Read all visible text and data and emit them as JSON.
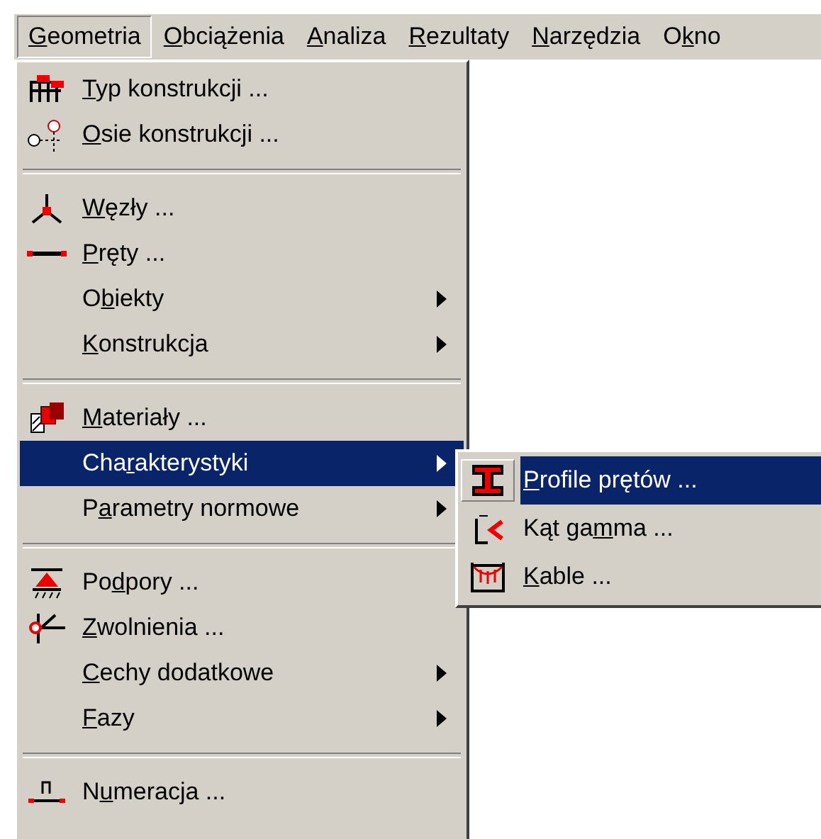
{
  "menubar": [
    {
      "key": "G",
      "post": "eometria",
      "selected": true
    },
    {
      "key": "O",
      "post": "bciążenia",
      "selected": false
    },
    {
      "key": "A",
      "post": "naliza",
      "selected": false
    },
    {
      "key": "R",
      "post": "ezultaty",
      "selected": false
    },
    {
      "key": "N",
      "post": "arzędzia",
      "selected": false
    },
    {
      "pre": "O",
      "key": "k",
      "post": "no",
      "selected": false
    }
  ],
  "menu": [
    {
      "kind": "item",
      "key": "T",
      "post": "yp konstrukcji ...",
      "submenu": false,
      "selected": false
    },
    {
      "kind": "item",
      "key": "O",
      "post": "sie konstrukcji ...",
      "submenu": false,
      "selected": false
    },
    {
      "kind": "separator"
    },
    {
      "kind": "item",
      "key": "W",
      "post": "ęzły ...",
      "submenu": false,
      "selected": false
    },
    {
      "kind": "item",
      "key": "P",
      "post": "ręty ...",
      "submenu": false,
      "selected": false
    },
    {
      "kind": "item",
      "pre": "O",
      "key": "b",
      "post": "iekty",
      "submenu": true,
      "selected": false
    },
    {
      "kind": "item",
      "key": "K",
      "post": "onstrukcja",
      "submenu": true,
      "selected": false
    },
    {
      "kind": "separator"
    },
    {
      "kind": "item",
      "key": "M",
      "post": "ateriały ...",
      "submenu": false,
      "selected": false
    },
    {
      "kind": "item",
      "pre": "Cha",
      "key": "r",
      "post": "akterystyki",
      "submenu": true,
      "selected": true
    },
    {
      "kind": "item",
      "pre": "P",
      "key": "a",
      "post": "rametry normowe",
      "submenu": true,
      "selected": false
    },
    {
      "kind": "separator"
    },
    {
      "kind": "item",
      "pre": "Po",
      "key": "d",
      "post": "pory ...",
      "submenu": false,
      "selected": false
    },
    {
      "kind": "item",
      "key": "Z",
      "post": "wolnienia ...",
      "submenu": false,
      "selected": false
    },
    {
      "kind": "item",
      "key": "C",
      "post": "echy dodatkowe",
      "submenu": true,
      "selected": false
    },
    {
      "kind": "item",
      "key": "F",
      "post": "azy",
      "submenu": true,
      "selected": false
    },
    {
      "kind": "separator"
    },
    {
      "kind": "item",
      "pre": "N",
      "key": "u",
      "post": "meracja ...",
      "submenu": false,
      "selected": false
    }
  ],
  "submenu": [
    {
      "kind": "item",
      "key": "P",
      "post": "rofile prętów ...",
      "submenu": false,
      "selected": true
    },
    {
      "kind": "item",
      "pre": "Kąt ga",
      "key": "m",
      "post": "ma ...",
      "submenu": false,
      "selected": false
    },
    {
      "kind": "item",
      "key": "K",
      "post": "able ...",
      "submenu": false,
      "selected": false
    }
  ]
}
